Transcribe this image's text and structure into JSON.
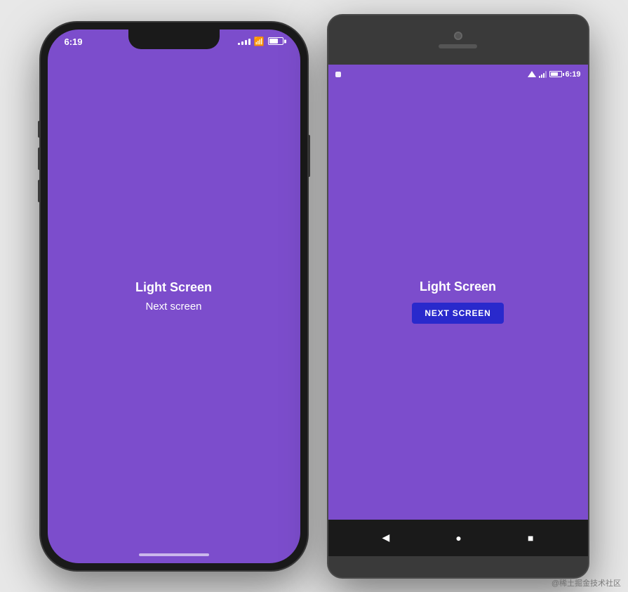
{
  "page": {
    "background_color": "#e8e8e8",
    "watermark": "@稀土掘金技术社区"
  },
  "ios": {
    "status": {
      "time": "6:19",
      "battery_label": "Battery"
    },
    "screen": {
      "background": "#7c4dcc",
      "title": "Light Screen",
      "subtitle": "Next screen"
    }
  },
  "android": {
    "status": {
      "time": "6:19",
      "battery_label": "Battery"
    },
    "screen": {
      "background": "#7c4dcc",
      "title": "Light Screen",
      "next_button": "NEXT SCREEN"
    },
    "nav": {
      "back": "◀",
      "home": "●",
      "recents": "■"
    }
  }
}
